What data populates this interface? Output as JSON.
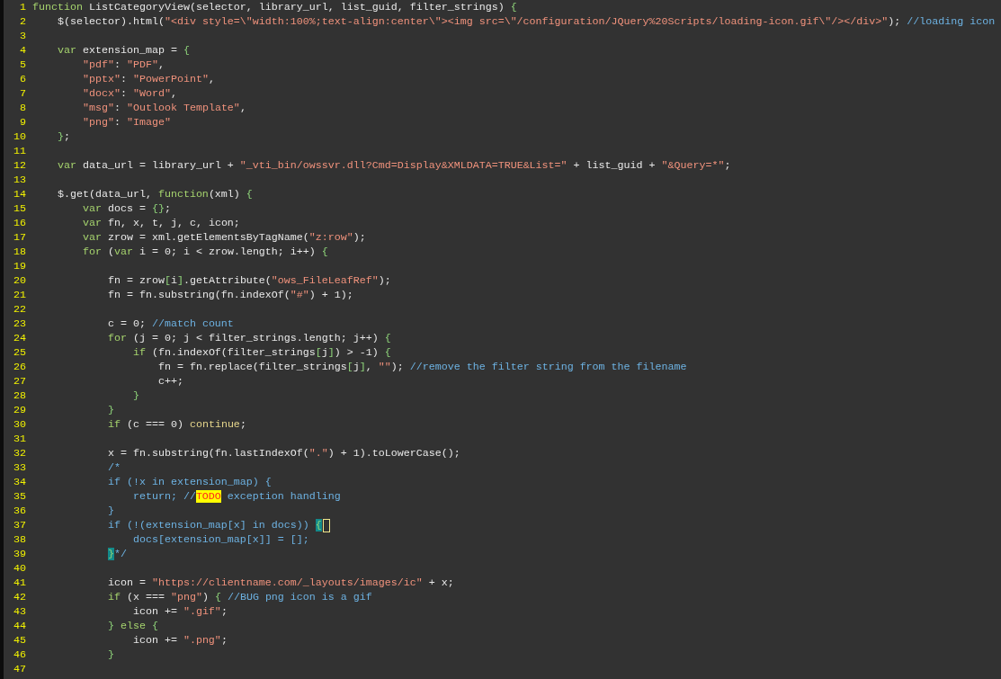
{
  "editor": {
    "lines": [
      {
        "number": "1",
        "cursor": false,
        "tokens": [
          {
            "kind": "keyword",
            "text": "function"
          },
          {
            "kind": "plain",
            "text": " ListCategoryView(selector, library_url, list_guid, filter_strings) "
          },
          {
            "kind": "brace",
            "text": "{"
          }
        ]
      },
      {
        "number": "2",
        "cursor": false,
        "tokens": [
          {
            "kind": "plain",
            "text": "    $(selector).html("
          },
          {
            "kind": "string",
            "text": "\"<div style=\\\"width:100%;text-align:center\\\"><img src=\\\"/configuration/JQuery%20Scripts/loading-icon.gif\\\"/></div>\""
          },
          {
            "kind": "plain",
            "text": "); "
          },
          {
            "kind": "comment",
            "text": "//loading icon"
          }
        ]
      },
      {
        "number": "3",
        "cursor": false
      },
      {
        "number": "4",
        "cursor": false,
        "tokens": [
          {
            "kind": "keyword",
            "text": "    var"
          },
          {
            "kind": "plain",
            "text": " extension_map = "
          },
          {
            "kind": "brace",
            "text": "{"
          }
        ]
      },
      {
        "number": "5",
        "cursor": false,
        "tokens": [
          {
            "kind": "string",
            "text": "        \"pdf\""
          },
          {
            "kind": "plain",
            "text": ": "
          },
          {
            "kind": "string",
            "text": "\"PDF\""
          },
          {
            "kind": "plain",
            "text": ","
          }
        ]
      },
      {
        "number": "6",
        "cursor": false,
        "tokens": [
          {
            "kind": "string",
            "text": "        \"pptx\""
          },
          {
            "kind": "plain",
            "text": ": "
          },
          {
            "kind": "string",
            "text": "\"PowerPoint\""
          },
          {
            "kind": "plain",
            "text": ","
          }
        ]
      },
      {
        "number": "7",
        "cursor": false,
        "tokens": [
          {
            "kind": "string",
            "text": "        \"docx\""
          },
          {
            "kind": "plain",
            "text": ": "
          },
          {
            "kind": "string",
            "text": "\"Word\""
          },
          {
            "kind": "plain",
            "text": ","
          }
        ]
      },
      {
        "number": "8",
        "cursor": false,
        "tokens": [
          {
            "kind": "string",
            "text": "        \"msg\""
          },
          {
            "kind": "plain",
            "text": ": "
          },
          {
            "kind": "string",
            "text": "\"Outlook Template\""
          },
          {
            "kind": "plain",
            "text": ","
          }
        ]
      },
      {
        "number": "9",
        "cursor": false,
        "tokens": [
          {
            "kind": "string",
            "text": "        \"png\""
          },
          {
            "kind": "plain",
            "text": ": "
          },
          {
            "kind": "string",
            "text": "\"Image\""
          }
        ]
      },
      {
        "number": "10",
        "cursor": false,
        "tokens": [
          {
            "kind": "brace",
            "text": "    }"
          },
          {
            "kind": "plain",
            "text": ";"
          }
        ]
      },
      {
        "number": "11",
        "cursor": false
      },
      {
        "number": "12",
        "cursor": false,
        "tokens": [
          {
            "kind": "keyword",
            "text": "    var"
          },
          {
            "kind": "plain",
            "text": " data_url = library_url + "
          },
          {
            "kind": "string",
            "text": "\"_vti_bin/owssvr.dll?Cmd=Display&XMLDATA=TRUE&List=\""
          },
          {
            "kind": "plain",
            "text": " + list_guid + "
          },
          {
            "kind": "string",
            "text": "\"&Query=*\""
          },
          {
            "kind": "plain",
            "text": ";"
          }
        ]
      },
      {
        "number": "13",
        "cursor": false
      },
      {
        "number": "14",
        "cursor": false,
        "tokens": [
          {
            "kind": "plain",
            "text": "    $.get(data_url, "
          },
          {
            "kind": "keyword",
            "text": "function"
          },
          {
            "kind": "plain",
            "text": "(xml) "
          },
          {
            "kind": "brace",
            "text": "{"
          }
        ]
      },
      {
        "number": "15",
        "cursor": false,
        "tokens": [
          {
            "kind": "keyword",
            "text": "        var"
          },
          {
            "kind": "plain",
            "text": " docs = "
          },
          {
            "kind": "brace",
            "text": "{}"
          },
          {
            "kind": "plain",
            "text": ";"
          }
        ]
      },
      {
        "number": "16",
        "cursor": false,
        "tokens": [
          {
            "kind": "keyword",
            "text": "        var"
          },
          {
            "kind": "plain",
            "text": " fn, x, t, j, c, icon;"
          }
        ]
      },
      {
        "number": "17",
        "cursor": false,
        "tokens": [
          {
            "kind": "keyword",
            "text": "        var"
          },
          {
            "kind": "plain",
            "text": " zrow = xml.getElementsByTagName("
          },
          {
            "kind": "string",
            "text": "\"z:row\""
          },
          {
            "kind": "plain",
            "text": ");"
          }
        ]
      },
      {
        "number": "18",
        "cursor": false,
        "tokens": [
          {
            "kind": "keyword",
            "text": "        for"
          },
          {
            "kind": "plain",
            "text": " ("
          },
          {
            "kind": "keyword",
            "text": "var"
          },
          {
            "kind": "plain",
            "text": " i = 0; i < zrow.length; i++) "
          },
          {
            "kind": "brace",
            "text": "{"
          }
        ]
      },
      {
        "number": "19",
        "cursor": false
      },
      {
        "number": "20",
        "cursor": false,
        "tokens": [
          {
            "kind": "plain",
            "text": "            fn = zrow"
          },
          {
            "kind": "brace",
            "text": "["
          },
          {
            "kind": "plain",
            "text": "i"
          },
          {
            "kind": "brace",
            "text": "]"
          },
          {
            "kind": "plain",
            "text": ".getAttribute("
          },
          {
            "kind": "string",
            "text": "\"ows_FileLeafRef\""
          },
          {
            "kind": "plain",
            "text": ");"
          }
        ]
      },
      {
        "number": "21",
        "cursor": false,
        "tokens": [
          {
            "kind": "plain",
            "text": "            fn = fn.substring(fn.indexOf("
          },
          {
            "kind": "string",
            "text": "\"#\""
          },
          {
            "kind": "plain",
            "text": ") + 1);"
          }
        ]
      },
      {
        "number": "22",
        "cursor": false
      },
      {
        "number": "23",
        "cursor": false,
        "tokens": [
          {
            "kind": "plain",
            "text": "            c = 0; "
          },
          {
            "kind": "comment",
            "text": "//match count"
          }
        ]
      },
      {
        "number": "24",
        "cursor": false,
        "tokens": [
          {
            "kind": "keyword",
            "text": "            for"
          },
          {
            "kind": "plain",
            "text": " (j = 0; j < filter_strings.length; j++) "
          },
          {
            "kind": "brace",
            "text": "{"
          }
        ]
      },
      {
        "number": "25",
        "cursor": false,
        "tokens": [
          {
            "kind": "keyword",
            "text": "                if"
          },
          {
            "kind": "plain",
            "text": " (fn.indexOf(filter_strings"
          },
          {
            "kind": "brace",
            "text": "["
          },
          {
            "kind": "plain",
            "text": "j"
          },
          {
            "kind": "brace",
            "text": "]"
          },
          {
            "kind": "plain",
            "text": ") > -1) "
          },
          {
            "kind": "brace",
            "text": "{"
          }
        ]
      },
      {
        "number": "26",
        "cursor": false,
        "tokens": [
          {
            "kind": "plain",
            "text": "                    fn = fn.replace(filter_strings"
          },
          {
            "kind": "brace",
            "text": "["
          },
          {
            "kind": "plain",
            "text": "j"
          },
          {
            "kind": "brace",
            "text": "]"
          },
          {
            "kind": "plain",
            "text": ", "
          },
          {
            "kind": "string",
            "text": "\"\""
          },
          {
            "kind": "plain",
            "text": "); "
          },
          {
            "kind": "comment",
            "text": "//remove the filter string from the filename"
          }
        ]
      },
      {
        "number": "27",
        "cursor": false,
        "tokens": [
          {
            "kind": "plain",
            "text": "                    c++;"
          }
        ]
      },
      {
        "number": "28",
        "cursor": false,
        "tokens": [
          {
            "kind": "brace",
            "text": "                }"
          }
        ]
      },
      {
        "number": "29",
        "cursor": false,
        "tokens": [
          {
            "kind": "brace",
            "text": "            }"
          }
        ]
      },
      {
        "number": "30",
        "cursor": false,
        "tokens": [
          {
            "kind": "keyword",
            "text": "            if"
          },
          {
            "kind": "plain",
            "text": " (c === 0) "
          },
          {
            "kind": "flow",
            "text": "continue"
          },
          {
            "kind": "plain",
            "text": ";"
          }
        ]
      },
      {
        "number": "31",
        "cursor": false
      },
      {
        "number": "32",
        "cursor": false,
        "tokens": [
          {
            "kind": "plain",
            "text": "            x = fn.substring(fn.lastIndexOf("
          },
          {
            "kind": "string",
            "text": "\".\""
          },
          {
            "kind": "plain",
            "text": ") + 1).toLowerCase();"
          }
        ]
      },
      {
        "number": "33",
        "cursor": false,
        "tokens": [
          {
            "kind": "comment",
            "text": "            /*"
          }
        ]
      },
      {
        "number": "34",
        "cursor": false,
        "tokens": [
          {
            "kind": "comment",
            "text": "            if (!x in extension_map) {"
          }
        ]
      },
      {
        "number": "35",
        "cursor": false,
        "tokens": [
          {
            "kind": "comment",
            "text": "                return; //"
          },
          {
            "kind": "todo",
            "text": "TODO"
          },
          {
            "kind": "comment",
            "text": " exception handling"
          }
        ]
      },
      {
        "number": "36",
        "cursor": false,
        "tokens": [
          {
            "kind": "comment",
            "text": "            }"
          }
        ]
      },
      {
        "number": "37",
        "cursor": true,
        "tokens": [
          {
            "kind": "comment",
            "text": "            if (!(extension_map[x] in docs)) "
          },
          {
            "kind": "match",
            "text": "{"
          }
        ]
      },
      {
        "number": "38",
        "cursor": false,
        "tokens": [
          {
            "kind": "comment",
            "text": "                docs[extension_map[x]] = [];"
          }
        ]
      },
      {
        "number": "39",
        "cursor": false,
        "tokens": [
          {
            "kind": "match",
            "text": "            }"
          },
          {
            "kind": "comment",
            "text": "*/"
          }
        ]
      },
      {
        "number": "40",
        "cursor": false
      },
      {
        "number": "41",
        "cursor": false,
        "tokens": [
          {
            "kind": "plain",
            "text": "            icon = "
          },
          {
            "kind": "string",
            "text": "\"https://clientname.com/_layouts/images/ic\""
          },
          {
            "kind": "plain",
            "text": " + x;"
          }
        ]
      },
      {
        "number": "42",
        "cursor": false,
        "tokens": [
          {
            "kind": "keyword",
            "text": "            if"
          },
          {
            "kind": "plain",
            "text": " (x === "
          },
          {
            "kind": "string",
            "text": "\"png\""
          },
          {
            "kind": "plain",
            "text": ") "
          },
          {
            "kind": "brace",
            "text": "{"
          },
          {
            "kind": "comment",
            "text": " //BUG png icon is a gif"
          }
        ]
      },
      {
        "number": "43",
        "cursor": false,
        "tokens": [
          {
            "kind": "plain",
            "text": "                icon += "
          },
          {
            "kind": "string",
            "text": "\".gif\""
          },
          {
            "kind": "plain",
            "text": ";"
          }
        ]
      },
      {
        "number": "44",
        "cursor": false,
        "tokens": [
          {
            "kind": "brace",
            "text": "            }"
          },
          {
            "kind": "keyword",
            "text": " else"
          },
          {
            "kind": "brace",
            "text": " {"
          }
        ]
      },
      {
        "number": "45",
        "cursor": false,
        "tokens": [
          {
            "kind": "plain",
            "text": "                icon += "
          },
          {
            "kind": "string",
            "text": "\".png\""
          },
          {
            "kind": "plain",
            "text": ";"
          }
        ]
      },
      {
        "number": "46",
        "cursor": false,
        "tokens": [
          {
            "kind": "brace",
            "text": "            }"
          }
        ]
      },
      {
        "number": "47",
        "cursor": false
      }
    ]
  }
}
